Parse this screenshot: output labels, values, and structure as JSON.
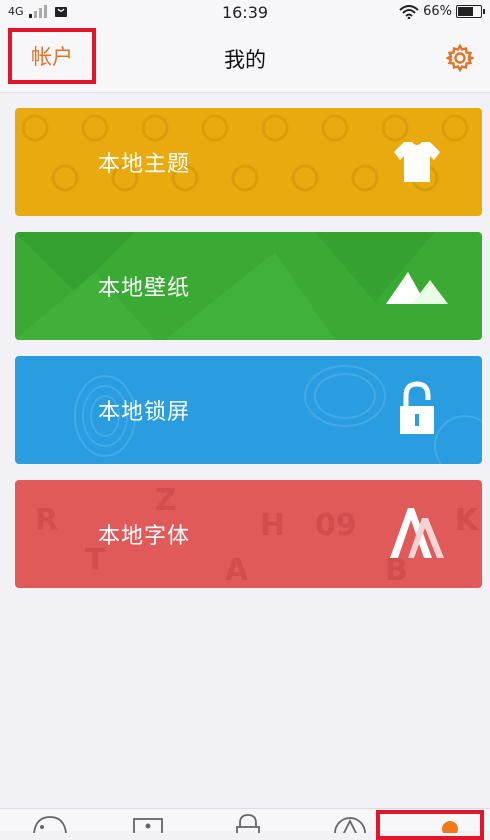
{
  "status_bar": {
    "network": "4G",
    "time": "16:39",
    "battery": "66%",
    "battery_level": 0.66
  },
  "header": {
    "account_label": "帐户",
    "title": "我的",
    "settings_icon": "gear-icon"
  },
  "cards": [
    {
      "label": "本地主题",
      "icon": "tshirt-icon",
      "color": "#e8aa0e"
    },
    {
      "label": "本地壁纸",
      "icon": "mountain-icon",
      "color": "#3aaa35"
    },
    {
      "label": "本地锁屏",
      "icon": "padlock-icon",
      "color": "#2a9de0"
    },
    {
      "label": "本地字体",
      "icon": "font-a-icon",
      "color": "#e05a5a"
    }
  ],
  "tabs": [
    {
      "icon": "palette-icon"
    },
    {
      "icon": "picture-icon"
    },
    {
      "icon": "lock-icon"
    },
    {
      "icon": "font-icon"
    },
    {
      "icon": "person-icon",
      "active": true
    }
  ],
  "colors": {
    "accent": "#e2742a",
    "highlight_box": "#e0162b"
  }
}
